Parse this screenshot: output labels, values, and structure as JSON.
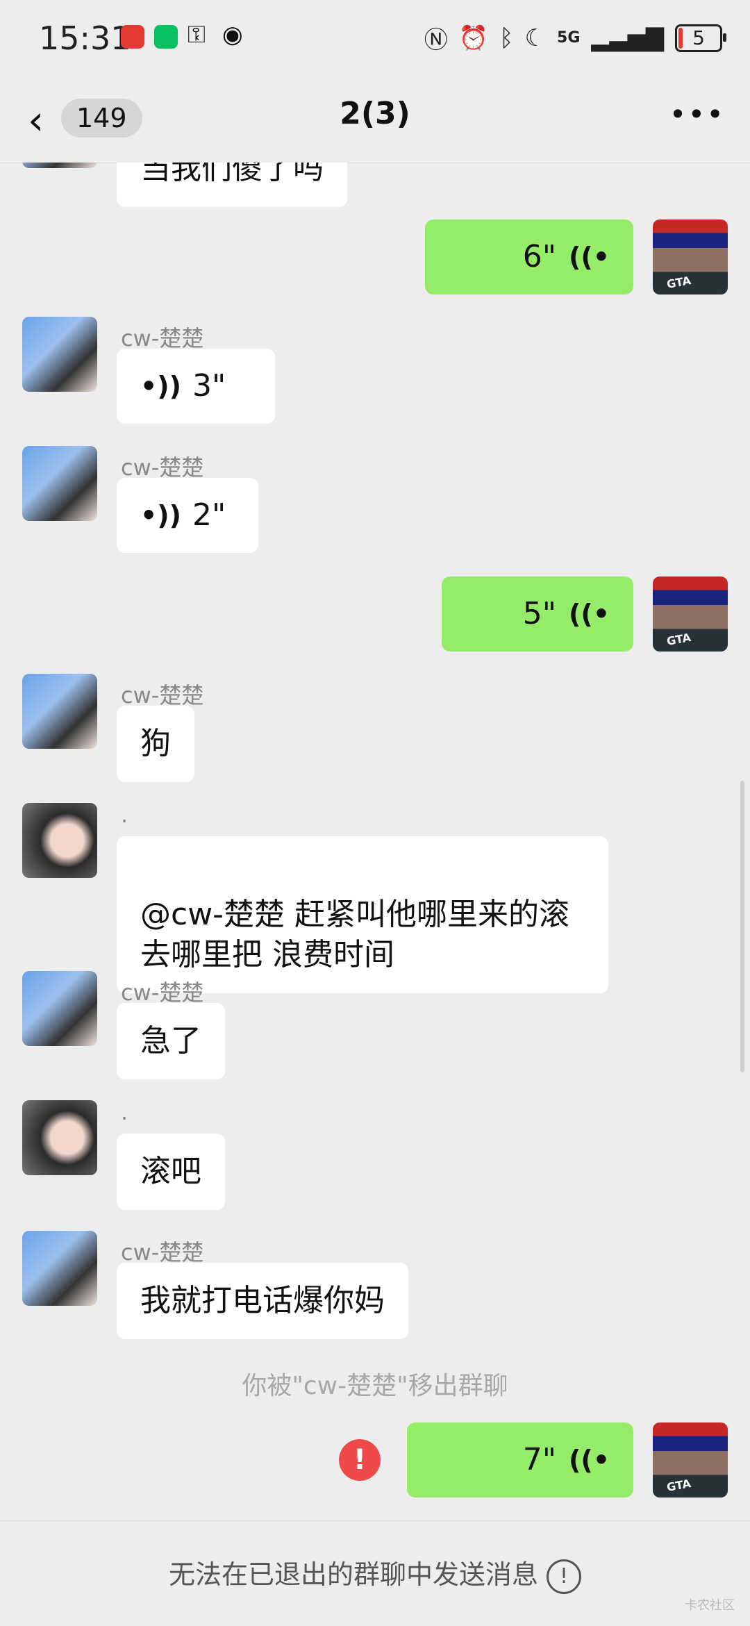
{
  "status_bar": {
    "time": "15:31",
    "battery": "5",
    "network": "5G"
  },
  "header": {
    "back_count": "149",
    "title": "2(3)"
  },
  "messages": [
    {
      "id": "m0",
      "text": "当我们傻了吗"
    },
    {
      "id": "m1",
      "duration": "6\""
    },
    {
      "id": "m2",
      "sender": "cw-楚楚",
      "duration": "3\""
    },
    {
      "id": "m3",
      "sender": "cw-楚楚",
      "duration": "2\""
    },
    {
      "id": "m4",
      "duration": "5\""
    },
    {
      "id": "m5",
      "sender": "cw-楚楚",
      "text": "狗"
    },
    {
      "id": "m6",
      "sender": ".",
      "text": "@cw-楚楚  赶紧叫他哪里来的滚\n去哪里把  浪费时间"
    },
    {
      "id": "m7",
      "sender": "cw-楚楚",
      "text": "急了"
    },
    {
      "id": "m8",
      "sender": ".",
      "text": "滚吧"
    },
    {
      "id": "m9",
      "sender": "cw-楚楚",
      "text": "我就打电话爆你妈"
    },
    {
      "id": "m10",
      "duration": "7\""
    }
  ],
  "system_notice": "你被\"cw-楚楚\"移出群聊",
  "footer": {
    "text": "无法在已退出的群聊中发送消息"
  },
  "watermark": "卡农社区"
}
